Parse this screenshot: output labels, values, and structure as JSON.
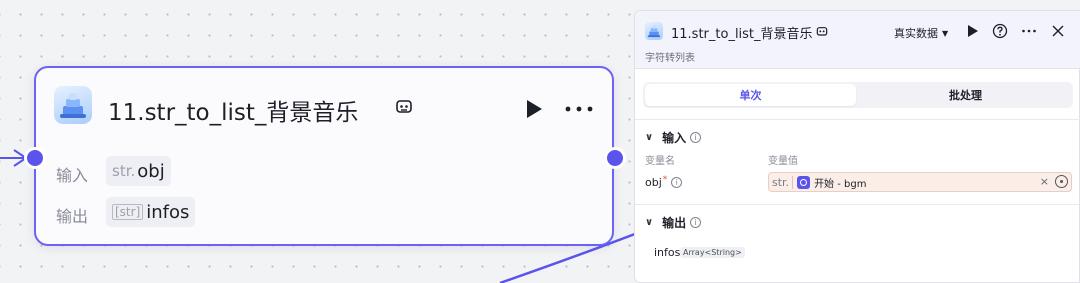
{
  "node": {
    "title": "11.str_to_list_背景音乐",
    "input_label": "输入",
    "input_type": "str.",
    "input_value": "obj",
    "output_label": "输出",
    "output_type": "[str]",
    "output_value": "infos"
  },
  "panel": {
    "title": "11.str_to_list_背景音乐",
    "subtitle": "字符转列表",
    "data_select": "真实数据",
    "tabs": [
      "单次",
      "批处理"
    ],
    "input_section": "输入",
    "col_var_name": "变量名",
    "col_var_value": "变量值",
    "input_var_name": "obj",
    "input_required_mark": "*",
    "input_var_type": "str.",
    "input_ref_text": "开始 - bgm",
    "input_clear": "×",
    "output_section": "输出",
    "output_var_name": "infos",
    "output_var_type": "Array<String>"
  },
  "icons": {
    "node": "workflow-node-icon",
    "run": "play-icon",
    "more": "more-icon",
    "help": "help-icon",
    "close": "close-icon",
    "title_badge": "robot-icon",
    "info": "info-icon",
    "collapse": "chevron-down-icon",
    "pick_variable": "target-icon"
  },
  "colors": {
    "accent": "#5a54ec",
    "node_border": "#6b63f3",
    "input_bg": "#fbeee8"
  }
}
